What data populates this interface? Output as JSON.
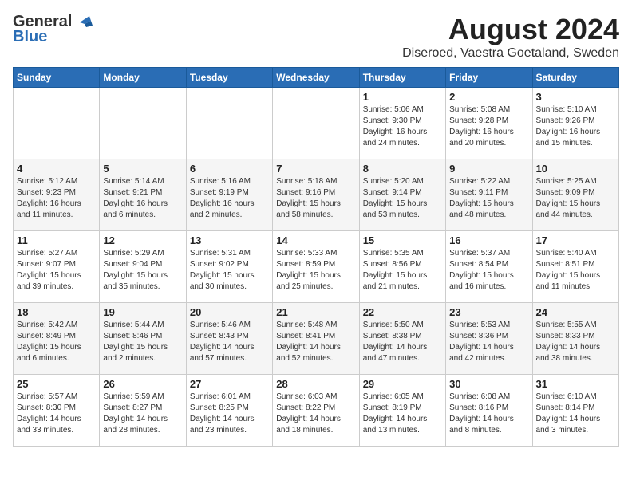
{
  "header": {
    "logo_line1": "General",
    "logo_line2": "Blue",
    "month_title": "August 2024",
    "location": "Diseroed, Vaestra Goetaland, Sweden"
  },
  "weekdays": [
    "Sunday",
    "Monday",
    "Tuesday",
    "Wednesday",
    "Thursday",
    "Friday",
    "Saturday"
  ],
  "weeks": [
    [
      {
        "day": "",
        "info": ""
      },
      {
        "day": "",
        "info": ""
      },
      {
        "day": "",
        "info": ""
      },
      {
        "day": "",
        "info": ""
      },
      {
        "day": "1",
        "info": "Sunrise: 5:06 AM\nSunset: 9:30 PM\nDaylight: 16 hours\nand 24 minutes."
      },
      {
        "day": "2",
        "info": "Sunrise: 5:08 AM\nSunset: 9:28 PM\nDaylight: 16 hours\nand 20 minutes."
      },
      {
        "day": "3",
        "info": "Sunrise: 5:10 AM\nSunset: 9:26 PM\nDaylight: 16 hours\nand 15 minutes."
      }
    ],
    [
      {
        "day": "4",
        "info": "Sunrise: 5:12 AM\nSunset: 9:23 PM\nDaylight: 16 hours\nand 11 minutes."
      },
      {
        "day": "5",
        "info": "Sunrise: 5:14 AM\nSunset: 9:21 PM\nDaylight: 16 hours\nand 6 minutes."
      },
      {
        "day": "6",
        "info": "Sunrise: 5:16 AM\nSunset: 9:19 PM\nDaylight: 16 hours\nand 2 minutes."
      },
      {
        "day": "7",
        "info": "Sunrise: 5:18 AM\nSunset: 9:16 PM\nDaylight: 15 hours\nand 58 minutes."
      },
      {
        "day": "8",
        "info": "Sunrise: 5:20 AM\nSunset: 9:14 PM\nDaylight: 15 hours\nand 53 minutes."
      },
      {
        "day": "9",
        "info": "Sunrise: 5:22 AM\nSunset: 9:11 PM\nDaylight: 15 hours\nand 48 minutes."
      },
      {
        "day": "10",
        "info": "Sunrise: 5:25 AM\nSunset: 9:09 PM\nDaylight: 15 hours\nand 44 minutes."
      }
    ],
    [
      {
        "day": "11",
        "info": "Sunrise: 5:27 AM\nSunset: 9:07 PM\nDaylight: 15 hours\nand 39 minutes."
      },
      {
        "day": "12",
        "info": "Sunrise: 5:29 AM\nSunset: 9:04 PM\nDaylight: 15 hours\nand 35 minutes."
      },
      {
        "day": "13",
        "info": "Sunrise: 5:31 AM\nSunset: 9:02 PM\nDaylight: 15 hours\nand 30 minutes."
      },
      {
        "day": "14",
        "info": "Sunrise: 5:33 AM\nSunset: 8:59 PM\nDaylight: 15 hours\nand 25 minutes."
      },
      {
        "day": "15",
        "info": "Sunrise: 5:35 AM\nSunset: 8:56 PM\nDaylight: 15 hours\nand 21 minutes."
      },
      {
        "day": "16",
        "info": "Sunrise: 5:37 AM\nSunset: 8:54 PM\nDaylight: 15 hours\nand 16 minutes."
      },
      {
        "day": "17",
        "info": "Sunrise: 5:40 AM\nSunset: 8:51 PM\nDaylight: 15 hours\nand 11 minutes."
      }
    ],
    [
      {
        "day": "18",
        "info": "Sunrise: 5:42 AM\nSunset: 8:49 PM\nDaylight: 15 hours\nand 6 minutes."
      },
      {
        "day": "19",
        "info": "Sunrise: 5:44 AM\nSunset: 8:46 PM\nDaylight: 15 hours\nand 2 minutes."
      },
      {
        "day": "20",
        "info": "Sunrise: 5:46 AM\nSunset: 8:43 PM\nDaylight: 14 hours\nand 57 minutes."
      },
      {
        "day": "21",
        "info": "Sunrise: 5:48 AM\nSunset: 8:41 PM\nDaylight: 14 hours\nand 52 minutes."
      },
      {
        "day": "22",
        "info": "Sunrise: 5:50 AM\nSunset: 8:38 PM\nDaylight: 14 hours\nand 47 minutes."
      },
      {
        "day": "23",
        "info": "Sunrise: 5:53 AM\nSunset: 8:36 PM\nDaylight: 14 hours\nand 42 minutes."
      },
      {
        "day": "24",
        "info": "Sunrise: 5:55 AM\nSunset: 8:33 PM\nDaylight: 14 hours\nand 38 minutes."
      }
    ],
    [
      {
        "day": "25",
        "info": "Sunrise: 5:57 AM\nSunset: 8:30 PM\nDaylight: 14 hours\nand 33 minutes."
      },
      {
        "day": "26",
        "info": "Sunrise: 5:59 AM\nSunset: 8:27 PM\nDaylight: 14 hours\nand 28 minutes."
      },
      {
        "day": "27",
        "info": "Sunrise: 6:01 AM\nSunset: 8:25 PM\nDaylight: 14 hours\nand 23 minutes."
      },
      {
        "day": "28",
        "info": "Sunrise: 6:03 AM\nSunset: 8:22 PM\nDaylight: 14 hours\nand 18 minutes."
      },
      {
        "day": "29",
        "info": "Sunrise: 6:05 AM\nSunset: 8:19 PM\nDaylight: 14 hours\nand 13 minutes."
      },
      {
        "day": "30",
        "info": "Sunrise: 6:08 AM\nSunset: 8:16 PM\nDaylight: 14 hours\nand 8 minutes."
      },
      {
        "day": "31",
        "info": "Sunrise: 6:10 AM\nSunset: 8:14 PM\nDaylight: 14 hours\nand 3 minutes."
      }
    ]
  ]
}
